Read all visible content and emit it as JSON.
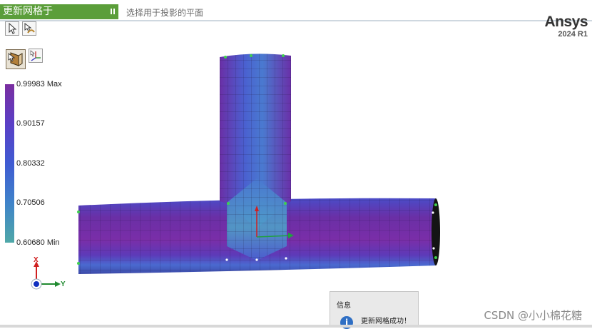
{
  "titlebar": {
    "tool_title": "更新网格于",
    "hint": "选择用于投影的平面"
  },
  "toolbar": {
    "icons": [
      "select-arrow-icon",
      "select-mode-icon",
      "face-select-icon",
      "view-triad-icon"
    ]
  },
  "brand": {
    "name": "Ansys",
    "version": "2024 R1"
  },
  "legend": {
    "labels": [
      "0.99983 Max",
      "0.90157",
      "0.80332",
      "0.70506",
      "0.60680 Min"
    ],
    "colors": [
      "#7a2ea0",
      "#5a3fc6",
      "#3f5bd2",
      "#3f83c9",
      "#4fa8a8"
    ]
  },
  "triad": {
    "x_label": "X",
    "y_label": "Y"
  },
  "message": {
    "header": "信息",
    "text": "更新网格成功！"
  },
  "watermark": "CSDN @小小棉花糖",
  "colors": {
    "title_green": "#5b9e3a",
    "mesh_purple": "#6a2fa6",
    "mesh_blue": "#4a5fd0"
  }
}
